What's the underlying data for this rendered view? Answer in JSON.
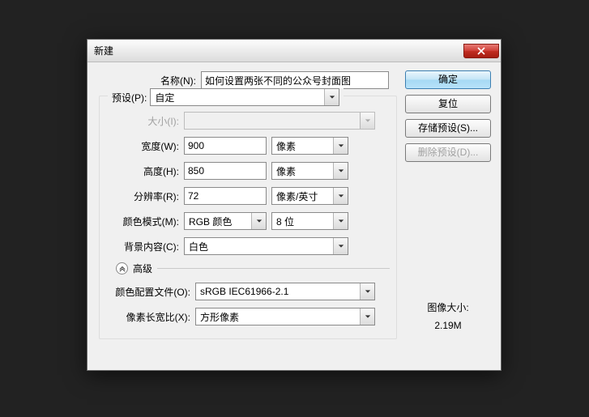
{
  "dialog": {
    "title": "新建",
    "name_label": "名称(N):",
    "name_value": "如何设置两张不同的公众号封面图",
    "preset_label": "预设(P):",
    "preset_value": "自定",
    "size_label": "大小(I):",
    "size_value": "",
    "width_label": "宽度(W):",
    "width_value": "900",
    "width_unit": "像素",
    "height_label": "高度(H):",
    "height_value": "850",
    "height_unit": "像素",
    "res_label": "分辨率(R):",
    "res_value": "72",
    "res_unit": "像素/英寸",
    "mode_label": "颜色模式(M):",
    "mode_value": "RGB 颜色",
    "bits_value": "8 位",
    "bg_label": "背景内容(C):",
    "bg_value": "白色",
    "advanced_label": "高级",
    "profile_label": "颜色配置文件(O):",
    "profile_value": "sRGB IEC61966-2.1",
    "aspect_label": "像素长宽比(X):",
    "aspect_value": "方形像素"
  },
  "buttons": {
    "ok": "确定",
    "reset": "复位",
    "save_preset": "存储预设(S)...",
    "delete_preset": "删除预设(D)..."
  },
  "info": {
    "label": "图像大小:",
    "value": "2.19M"
  }
}
